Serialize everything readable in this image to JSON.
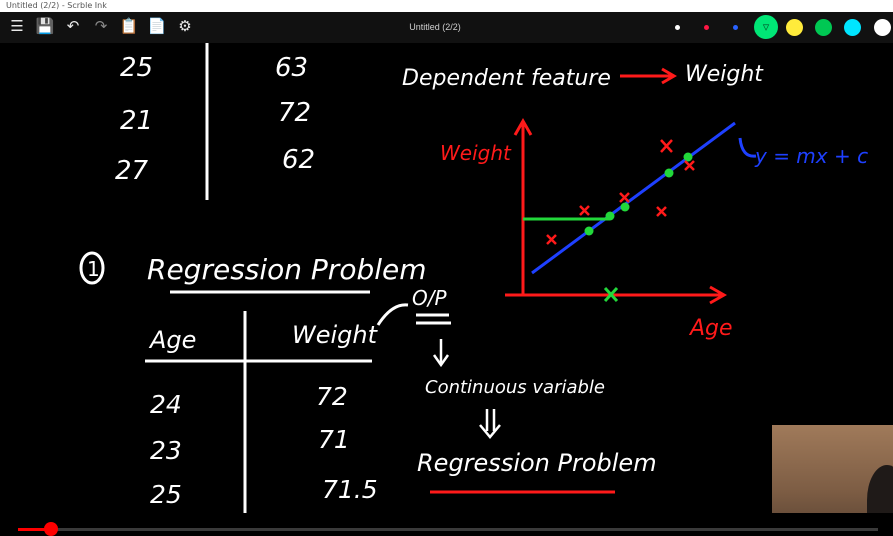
{
  "window": {
    "title": "Untitled (2/2) - Scrble Ink"
  },
  "toolbar": {
    "doc_title": "Untitled (2/2)",
    "icons": [
      "menu-icon",
      "save-icon",
      "undo-icon",
      "redo-icon",
      "paste-icon",
      "page-icon",
      "settings-icon"
    ],
    "pen_colors": [
      "#ffffff",
      "#ff1744",
      "#2962ff",
      "#00e676",
      "#ffeb3b",
      "#00c853",
      "#00e5ff"
    ]
  },
  "board": {
    "top_table": {
      "ages": [
        "25",
        "21",
        "27"
      ],
      "weights": [
        "63",
        "72",
        "62"
      ]
    },
    "feature_line": {
      "left": "Dependent feature",
      "right": "Weight"
    },
    "plot": {
      "y_label": "Weight",
      "x_label": "Age",
      "equation": "y = mx + c"
    },
    "section": {
      "number": "1",
      "title": "Regression Problem"
    },
    "table": {
      "headers": [
        "Age",
        "Weight"
      ],
      "rows": [
        [
          "24",
          "72"
        ],
        [
          "23",
          "71"
        ],
        [
          "25",
          "71.5"
        ]
      ]
    },
    "notes": {
      "output": "O/P",
      "continuous": "Continuous variable",
      "regression": "Regression Problem"
    }
  },
  "player": {
    "progress": 0.04
  }
}
